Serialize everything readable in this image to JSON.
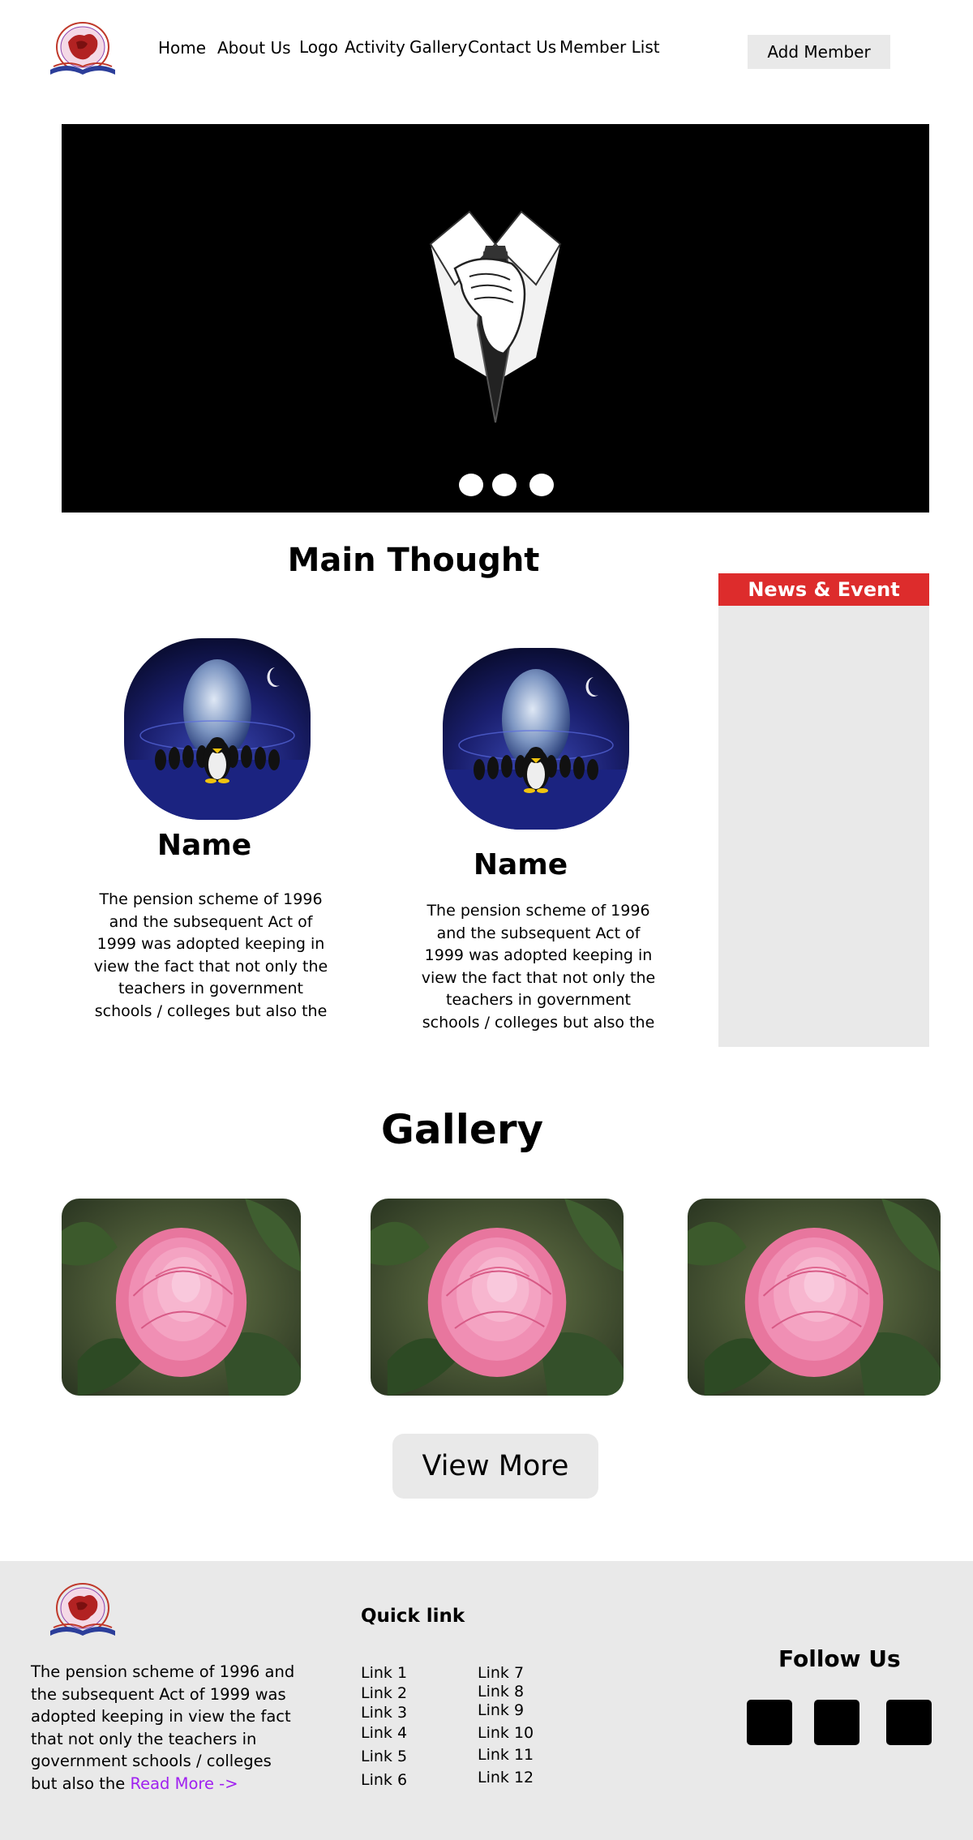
{
  "header": {
    "nav": [
      "Home",
      "About Us",
      "Logo",
      "Activity",
      "Gallery",
      "Contact Us",
      "Member List"
    ],
    "add_member": "Add Member"
  },
  "main_thought": {
    "title": "Main Thought",
    "people": [
      {
        "name": "Name",
        "text": "The pension scheme of 1996 and the subsequent     Act of 1999 was adopted keeping in view the fact that not only the teachers in government schools / colleges but also the"
      },
      {
        "name": "Name",
        "text": "The pension scheme of 1996 and the subsequent     Act of 1999 was adopted keeping in view the fact that not only the teachers in government schools / colleges but also the"
      }
    ]
  },
  "news": {
    "title": "News & Event"
  },
  "gallery": {
    "title": "Gallery",
    "view_more": "View More"
  },
  "footer": {
    "text": "The pension scheme of 1996 and the subsequent     Act of 1999 was adopted keeping in view the fact that not only the teachers in government schools / colleges but also the ",
    "read_more": "Read More ->",
    "quick_title": "Quick link",
    "links_left": [
      "Link 1",
      "Link 2",
      "Link 3",
      "Link 4",
      "Link 5",
      "Link 6"
    ],
    "links_right": [
      "Link 7",
      "Link 8",
      "Link 9",
      "Link 10",
      "Link 11",
      "Link 12"
    ],
    "follow": "Follow Us"
  },
  "colors": {
    "news_header": "#dd2c2c",
    "panel_grey": "#e9e9e9",
    "read_more": "#a020f0"
  }
}
